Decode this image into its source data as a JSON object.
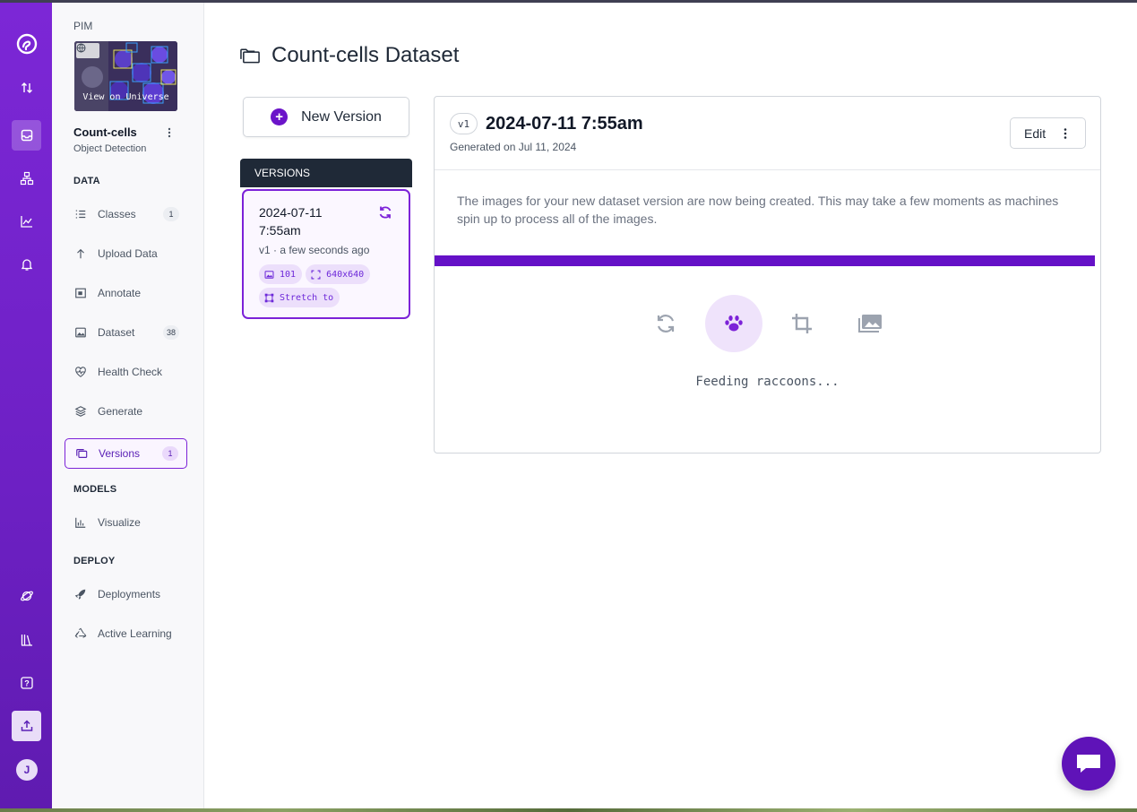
{
  "workspace": "PIM",
  "project": {
    "name": "Count-cells",
    "type": "Object Detection",
    "thumbnail_link": "View on Universe"
  },
  "rail": {
    "icons": [
      "roboflow-logo-icon",
      "sort-arrows-icon",
      "inbox-icon",
      "workflow-icon",
      "analytics-icon",
      "bell-icon",
      "universe-icon",
      "library-icon",
      "help-icon",
      "upload-icon"
    ],
    "avatar_initial": "J"
  },
  "sidebar": {
    "data_heading": "DATA",
    "data_items": [
      {
        "label": "Classes",
        "count": "1",
        "icon": "list-icon"
      },
      {
        "label": "Upload Data",
        "icon": "upload-arrow-icon"
      },
      {
        "label": "Annotate",
        "icon": "annotate-icon"
      },
      {
        "label": "Dataset",
        "count": "38",
        "icon": "image-icon"
      },
      {
        "label": "Health Check",
        "icon": "heart-pulse-icon"
      },
      {
        "label": "Generate",
        "icon": "layers-icon"
      },
      {
        "label": "Versions",
        "count": "1",
        "icon": "versions-icon"
      }
    ],
    "models_heading": "MODELS",
    "models_items": [
      {
        "label": "Visualize",
        "icon": "bar-chart-icon"
      }
    ],
    "deploy_heading": "DEPLOY",
    "deploy_items": [
      {
        "label": "Deployments",
        "icon": "rocket-icon"
      },
      {
        "label": "Active Learning",
        "icon": "recycle-icon"
      }
    ]
  },
  "main": {
    "title": "Count-cells Dataset",
    "new_version_label": "New Version",
    "versions_heading": "VERSIONS",
    "version_card": {
      "date": "2024-07-11 7:55am",
      "meta": "v1 · a few seconds ago",
      "chips": [
        {
          "label": "101",
          "icon": "image-icon"
        },
        {
          "label": "640x640",
          "icon": "resize-icon"
        },
        {
          "label": "Stretch to",
          "icon": "stretch-icon"
        }
      ]
    },
    "detail": {
      "version_tag": "v1",
      "title": "2024-07-11 7:55am",
      "generated": "Generated on Jul 11, 2024",
      "edit_label": "Edit",
      "message": "The images for your new dataset version are now being created. This may take a few moments as machines spin up to process all of the images.",
      "progress": 1.0,
      "status": "Feeding raccoons...",
      "steps": [
        "sync-icon",
        "paw-icon",
        "crop-icon",
        "images-icon"
      ],
      "current_step": "paw-icon"
    }
  },
  "colors": {
    "brand_purple": "#6511c7",
    "rail_purple": "#7c27d6",
    "dark_header": "#1f2937"
  }
}
